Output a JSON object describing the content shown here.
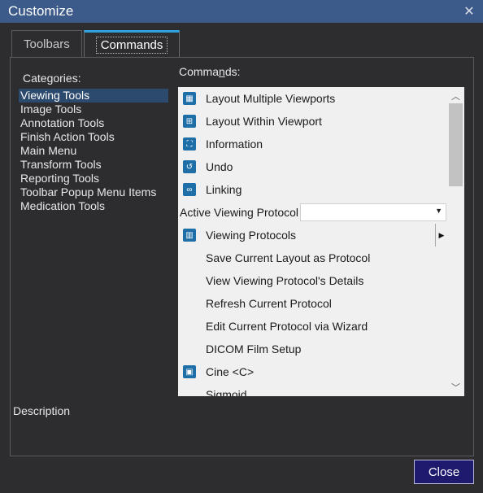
{
  "window": {
    "title": "Customize",
    "close_glyph": "✕"
  },
  "tabs": [
    {
      "label": "Toolbars"
    },
    {
      "label": "Commands"
    }
  ],
  "categories": {
    "label": "Categories:",
    "items": [
      "Viewing Tools",
      "Image Tools",
      "Annotation Tools",
      "Finish Action Tools",
      "Main Menu",
      "Transform Tools",
      "Reporting Tools",
      "Toolbar Popup Menu Items",
      "Medication Tools"
    ],
    "selected": "Viewing Tools"
  },
  "commands": {
    "label_prefix": "Comma",
    "label_mnemonic": "n",
    "label_suffix": "ds:",
    "items": [
      {
        "label": "Layout Multiple Viewports",
        "icon": "grid-icon"
      },
      {
        "label": "Layout Within Viewport",
        "icon": "plus-box-icon"
      },
      {
        "label": "Information",
        "icon": "corners-icon"
      },
      {
        "label": "Undo",
        "icon": "undo-icon"
      },
      {
        "label": "Linking",
        "icon": "link-icon"
      },
      {
        "label": "Active Viewing Protocol",
        "icon": "",
        "combo_value": ""
      },
      {
        "label": "Viewing Protocols",
        "icon": "book-icon",
        "submenu": true
      },
      {
        "label": "Save Current Layout as Protocol",
        "icon": ""
      },
      {
        "label": "View Viewing Protocol's Details",
        "icon": ""
      },
      {
        "label": "Refresh Current Protocol",
        "icon": ""
      },
      {
        "label": "Edit Current Protocol via Wizard",
        "icon": ""
      },
      {
        "label": "DICOM Film Setup",
        "icon": ""
      },
      {
        "label": "Cine <C>",
        "icon": "film-icon"
      },
      {
        "label": "Sigmoid",
        "icon": ""
      }
    ]
  },
  "description": {
    "label": "Description"
  },
  "buttons": {
    "close": "Close"
  }
}
